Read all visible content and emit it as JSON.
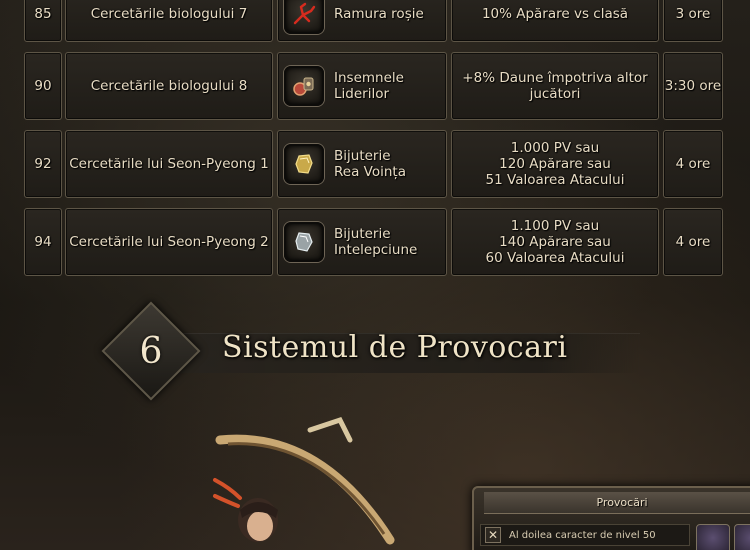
{
  "table": {
    "rows": [
      {
        "level": "85",
        "name": "Cercetările biologului 7",
        "item_icon": "red-branch-icon",
        "item_label": [
          "Ramura roșie"
        ],
        "effect": [
          "10% Apărare vs clasă"
        ],
        "time": "3 ore"
      },
      {
        "level": "90",
        "name": "Cercetările biologului 8",
        "item_icon": "leader-insignia-icon",
        "item_label": [
          "Insemnele",
          "Liderilor"
        ],
        "effect": [
          "+8% Daune împotriva altor",
          "jucători"
        ],
        "time": "3:30 ore"
      },
      {
        "level": "92",
        "name": "Cercetările lui Seon-Pyeong 1",
        "item_icon": "gold-jewel-icon",
        "item_label": [
          "Bijuterie",
          "Rea Voința"
        ],
        "effect": [
          "1.000 PV sau",
          "120 Apărare sau",
          "51 Valoarea Atacului"
        ],
        "time": "4 ore"
      },
      {
        "level": "94",
        "name": "Cercetările lui Seon-Pyeong 2",
        "item_icon": "silver-jewel-icon",
        "item_label": [
          "Bijuterie",
          "Intelepciune"
        ],
        "effect": [
          "1.100 PV sau",
          "140 Apărare sau",
          "60 Valoarea Atacului"
        ],
        "time": "4 ore"
      }
    ]
  },
  "section": {
    "number": "6",
    "title": "Sistemul de Provocari"
  },
  "panel": {
    "title": "Provocări",
    "row_text": "Al doilea caracter de nivel 50",
    "check_mark": "✕"
  },
  "colors": {
    "accent": "#e8dcc4",
    "border": "#5d5546"
  }
}
